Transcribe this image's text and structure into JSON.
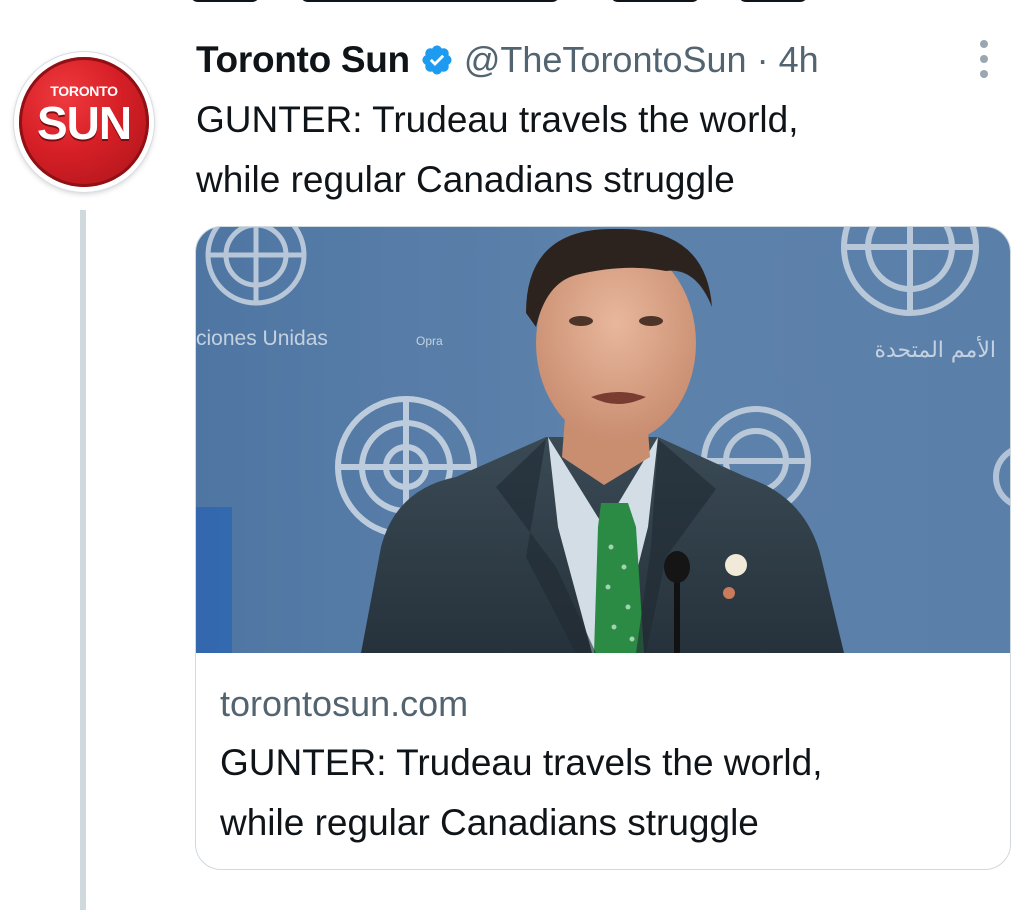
{
  "tweet": {
    "avatar": {
      "small_text": "TORONTO",
      "big_text": "SUN",
      "color": "#d61f26"
    },
    "display_name": "Toronto Sun",
    "verified_icon": "verified-badge-icon",
    "handle": "@TheTorontoSun",
    "separator": "·",
    "timestamp": "4h",
    "more_icon": "more-vertical-icon",
    "text": "GUNTER: Trudeau travels the world,\nwhile regular Canadians struggle"
  },
  "card": {
    "image_background_texts": {
      "left": "ciones Unidas",
      "center": "Opra",
      "right_arabic": "الأمم المتحدة"
    },
    "domain": "torontosun.com",
    "title": "GUNTER: Trudeau travels the world,\nwhile regular Canadians struggle"
  },
  "colors": {
    "text_primary": "#0f1419",
    "text_secondary": "#536471",
    "verified_blue": "#1d9bf0",
    "border": "#cfd9de",
    "thread_line": "#cfd9de",
    "un_blue": "#5b7fa6"
  }
}
